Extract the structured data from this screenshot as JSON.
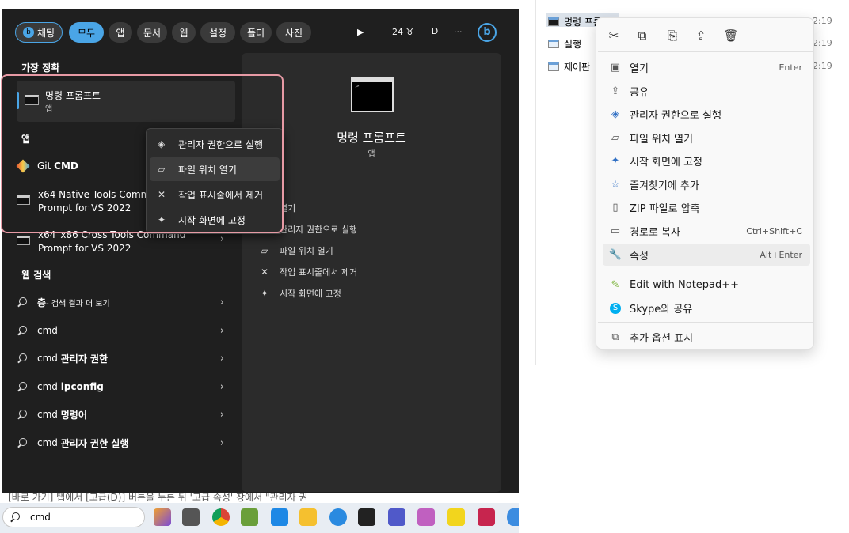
{
  "startmenu": {
    "filters": [
      "채팅",
      "모두",
      "앱",
      "문서",
      "웹",
      "설정",
      "폴더",
      "사진"
    ],
    "play_label": "▶",
    "weather": "24",
    "profile_initial": "D",
    "more_label": "···",
    "best_match_title": "가장 정확",
    "best_match": {
      "name": "명령 프롬프트",
      "type": "앱"
    },
    "apps_title": "앱",
    "apps": [
      {
        "name": "Git CMD",
        "prefix": "Git ",
        "bold": "CMD"
      },
      {
        "line1": "x64 Native Tools Comm",
        "line2": "Prompt for VS 2022"
      },
      {
        "line1": "x64_x86 Cross Tools Command",
        "line2": "Prompt for VS 2022"
      }
    ],
    "web_title": "웹 검색",
    "web": [
      {
        "prefix": "층",
        "suffix": " - 검색 결과 더 보기"
      },
      {
        "prefix": "cmd",
        "suffix": ""
      },
      {
        "prefix": "cmd ",
        "suffix": "관리자 권한"
      },
      {
        "prefix": "cmd ",
        "suffix": "ipconfig"
      },
      {
        "prefix": "cmd ",
        "suffix": "명령어"
      },
      {
        "prefix": "cmd ",
        "suffix": "관리자 권한 실행"
      }
    ],
    "preview": {
      "title": "명령 프롬프트",
      "subtitle": "앱"
    },
    "preview_actions": [
      "열기",
      "관리자 권한으로 실행",
      "파일 위치 열기",
      "작업 표시줄에서 제거",
      "시작 화면에 고정"
    ],
    "context_menu": [
      "관리자 권한으로 실행",
      "파일 위치 열기",
      "작업 표시줄에서 제거",
      "시작 화면에 고정"
    ]
  },
  "behind_text": "[바로 가기] 탭에서 [고급(D)] 버튼을 누른 뒤 '고급 속성' 창에서 \"관리자 권",
  "taskbar": {
    "search_value": "cmd"
  },
  "explorer": {
    "files": [
      {
        "name": "명령 프롬프트",
        "time": "2:19"
      },
      {
        "name": "실행",
        "time": "2:19"
      },
      {
        "name": "제어판",
        "time": "2:19"
      }
    ],
    "context_menu": [
      {
        "label": "열기",
        "shortcut": "Enter",
        "icon": "open-icon"
      },
      {
        "label": "공유",
        "shortcut": "",
        "icon": "share-icon"
      },
      {
        "label": "관리자 권한으로 실행",
        "shortcut": "",
        "icon": "shield-icon"
      },
      {
        "label": "파일 위치 열기",
        "shortcut": "",
        "icon": "folder-icon"
      },
      {
        "label": "시작 화면에 고정",
        "shortcut": "",
        "icon": "pin-icon"
      },
      {
        "label": "즐겨찾기에 추가",
        "shortcut": "",
        "icon": "star-icon"
      },
      {
        "label": "ZIP 파일로 압축",
        "shortcut": "",
        "icon": "zip-icon"
      },
      {
        "label": "경로로 복사",
        "shortcut": "Ctrl+Shift+C",
        "icon": "copy-path-icon"
      },
      {
        "label": "속성",
        "shortcut": "Alt+Enter",
        "icon": "wrench-icon"
      },
      {
        "label": "Edit with Notepad++",
        "shortcut": "",
        "icon": "notepadpp-icon"
      },
      {
        "label": "Skype와 공유",
        "shortcut": "",
        "icon": "skype-icon"
      },
      {
        "label": "추가 옵션 표시",
        "shortcut": "",
        "icon": "more-options-icon"
      }
    ]
  }
}
